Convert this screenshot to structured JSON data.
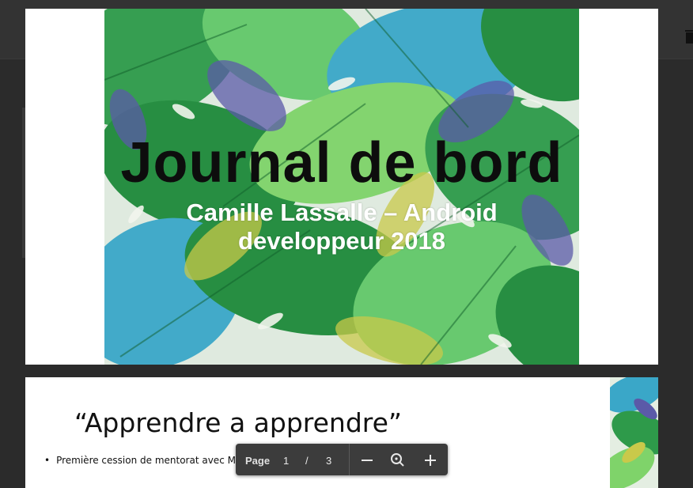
{
  "slides": [
    {
      "title": "Journal de bord",
      "subtitle": "Camille Lassalle – Android developpeur 2018"
    },
    {
      "title": "“Apprendre a apprendre”",
      "bullet": "Première cession de mentorat avec M"
    }
  ],
  "toolbar": {
    "page_label": "Page",
    "current_page": "1",
    "separator": "/",
    "total_pages": "3",
    "icons": [
      "minus-icon",
      "zoom-reset-icon",
      "plus-icon"
    ]
  },
  "background": {
    "icons": [
      "trash-icon"
    ]
  },
  "colors": {
    "overlay": "#2b2b2b",
    "toolbar": "#3c3c3c",
    "leaf_dark": "#1e8a3a",
    "leaf_light": "#7fd36a",
    "leaf_blue": "#3aa7c8",
    "leaf_purple": "#5b5aa8",
    "leaf_yellow": "#c9c94a"
  }
}
